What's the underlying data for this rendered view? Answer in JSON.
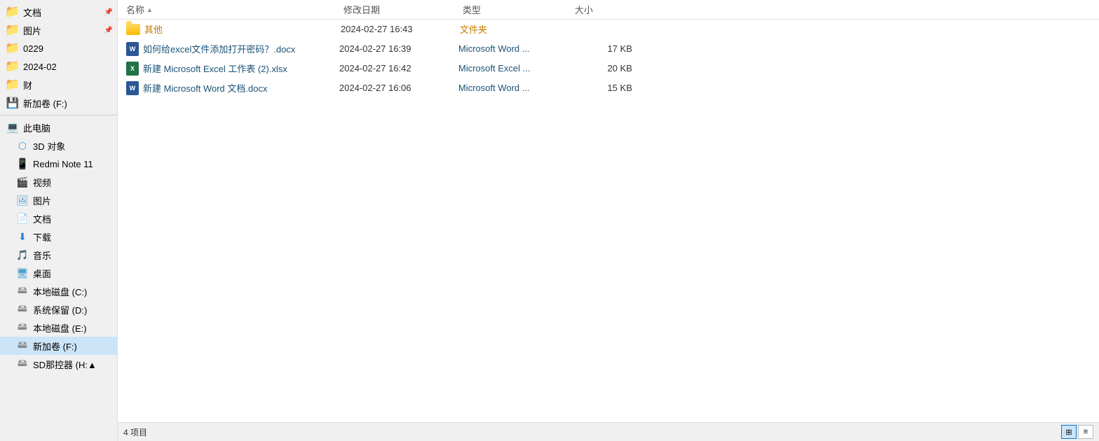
{
  "sidebar": {
    "items": [
      {
        "id": "documents",
        "label": "文档",
        "icon": "folder",
        "pinned": true
      },
      {
        "id": "pictures",
        "label": "图片",
        "icon": "folder",
        "pinned": true
      },
      {
        "id": "folder-0229",
        "label": "0229",
        "icon": "folder",
        "pinned": false
      },
      {
        "id": "folder-2024-02",
        "label": "2024-02",
        "icon": "folder",
        "pinned": false
      },
      {
        "id": "folder-cai",
        "label": "财",
        "icon": "folder",
        "pinned": false
      },
      {
        "id": "drive-f",
        "label": "新加卷 (F:)",
        "icon": "drive",
        "pinned": false
      },
      {
        "id": "this-pc",
        "label": "此电脑",
        "icon": "pc",
        "pinned": false
      },
      {
        "id": "3d-objects",
        "label": "3D 对象",
        "icon": "3d",
        "pinned": false
      },
      {
        "id": "redmi-note",
        "label": "Redmi Note 11",
        "icon": "phone",
        "pinned": false
      },
      {
        "id": "video",
        "label": "视频",
        "icon": "video",
        "pinned": false
      },
      {
        "id": "pictures2",
        "label": "图片",
        "icon": "image",
        "pinned": false
      },
      {
        "id": "documents2",
        "label": "文档",
        "icon": "doc",
        "pinned": false
      },
      {
        "id": "downloads",
        "label": "下载",
        "icon": "dl",
        "pinned": false
      },
      {
        "id": "music",
        "label": "音乐",
        "icon": "music",
        "pinned": false
      },
      {
        "id": "desktop",
        "label": "桌面",
        "icon": "desktop",
        "pinned": false
      },
      {
        "id": "disk-c",
        "label": "本地磁盘 (C:)",
        "icon": "disk",
        "pinned": false
      },
      {
        "id": "disk-d",
        "label": "系统保留 (D:)",
        "icon": "disk",
        "pinned": false
      },
      {
        "id": "disk-e",
        "label": "本地磁盘 (E:)",
        "icon": "disk",
        "pinned": false
      },
      {
        "id": "disk-f-active",
        "label": "新加卷 (F:)",
        "icon": "disk",
        "active": true,
        "pinned": false
      },
      {
        "id": "disk-more",
        "label": "SD那控器 (H:▲",
        "icon": "disk",
        "pinned": false
      }
    ]
  },
  "columns": {
    "name": "名称",
    "date": "修改日期",
    "type": "类型",
    "size": "大小",
    "sort_arrow": "▲"
  },
  "files": [
    {
      "name": "其他",
      "date": "2024-02-27 16:43",
      "type": "文件夹",
      "size": "",
      "file_type": "folder"
    },
    {
      "name": "如何给excel文件添加打开密码？.docx",
      "date": "2024-02-27 16:39",
      "type": "Microsoft Word ...",
      "size": "17 KB",
      "file_type": "word"
    },
    {
      "name": "新建 Microsoft Excel 工作表 (2).xlsx",
      "date": "2024-02-27 16:42",
      "type": "Microsoft Excel ...",
      "size": "20 KB",
      "file_type": "excel"
    },
    {
      "name": "新建 Microsoft Word 文档.docx",
      "date": "2024-02-27 16:06",
      "type": "Microsoft Word ...",
      "size": "15 KB",
      "file_type": "word"
    }
  ],
  "status": {
    "item_count": "4 项目"
  }
}
